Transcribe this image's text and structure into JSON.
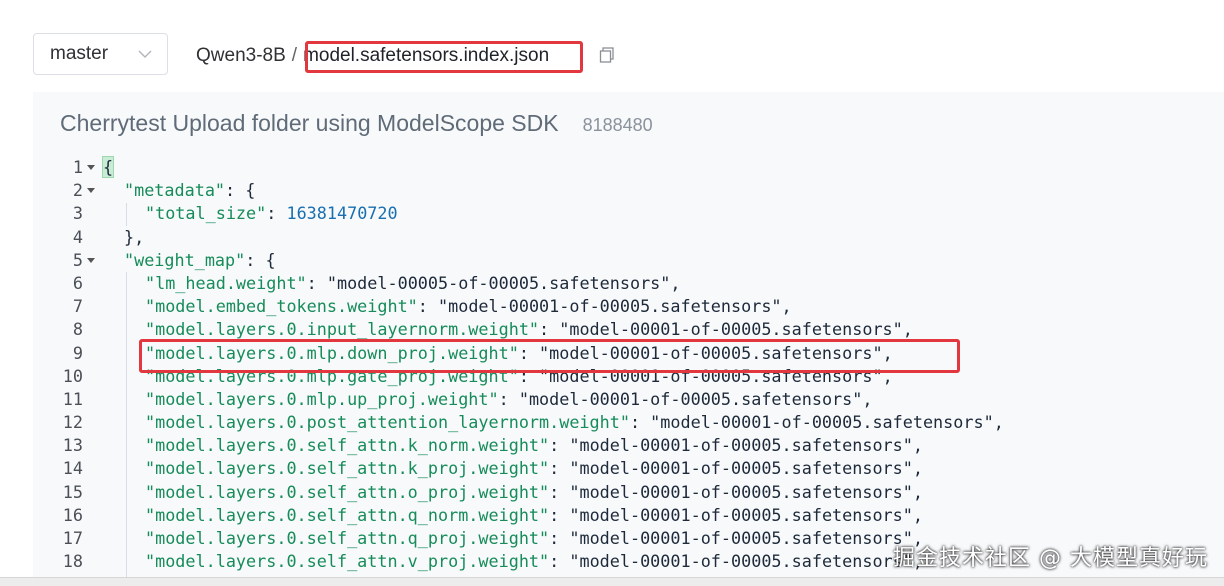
{
  "branch": {
    "selected": "master",
    "chevron_icon": "chevron-down-icon"
  },
  "breadcrumb": {
    "repo": "Qwen3-8B",
    "separator": "/",
    "file": "model.safetensors.index.json",
    "copy_icon": "copy-icon"
  },
  "commit": {
    "message": "Cherrytest Upload folder using ModelScope SDK",
    "hash": "8188480"
  },
  "code_lines": [
    {
      "n": "1",
      "text": "{"
    },
    {
      "n": "2",
      "key": "\"metadata\"",
      "rest": ": {"
    },
    {
      "n": "3",
      "key": "\"total_size\"",
      "sep": ": ",
      "num": "16381470720"
    },
    {
      "n": "4",
      "text": "},"
    },
    {
      "n": "5",
      "key": "\"weight_map\"",
      "rest": ": {"
    },
    {
      "n": "6",
      "key": "\"lm_head.weight\"",
      "sep": ": ",
      "val": "\"model-00005-of-00005.safetensors\"",
      "end": ","
    },
    {
      "n": "7",
      "key": "\"model.embed_tokens.weight\"",
      "sep": ": ",
      "val": "\"model-00001-of-00005.safetensors\"",
      "end": ","
    },
    {
      "n": "8",
      "key": "\"model.layers.0.input_layernorm.weight\"",
      "sep": ": ",
      "val": "\"model-00001-of-00005.safetensors\"",
      "end": ","
    },
    {
      "n": "9",
      "key": "\"model.layers.0.mlp.down_proj.weight\"",
      "sep": ": ",
      "val": "\"model-00001-of-00005.safetensors\"",
      "end": ","
    },
    {
      "n": "10",
      "key": "\"model.layers.0.mlp.gate_proj.weight\"",
      "sep": ": ",
      "val": "\"model-00001-of-00005.safetensors\"",
      "end": ","
    },
    {
      "n": "11",
      "key": "\"model.layers.0.mlp.up_proj.weight\"",
      "sep": ": ",
      "val": "\"model-00001-of-00005.safetensors\"",
      "end": ","
    },
    {
      "n": "12",
      "key": "\"model.layers.0.post_attention_layernorm.weight\"",
      "sep": ": ",
      "val": "\"model-00001-of-00005.safetensors\"",
      "end": ","
    },
    {
      "n": "13",
      "key": "\"model.layers.0.self_attn.k_norm.weight\"",
      "sep": ": ",
      "val": "\"model-00001-of-00005.safetensors\"",
      "end": ","
    },
    {
      "n": "14",
      "key": "\"model.layers.0.self_attn.k_proj.weight\"",
      "sep": ": ",
      "val": "\"model-00001-of-00005.safetensors\"",
      "end": ","
    },
    {
      "n": "15",
      "key": "\"model.layers.0.self_attn.o_proj.weight\"",
      "sep": ": ",
      "val": "\"model-00001-of-00005.safetensors\"",
      "end": ","
    },
    {
      "n": "16",
      "key": "\"model.layers.0.self_attn.q_norm.weight\"",
      "sep": ": ",
      "val": "\"model-00001-of-00005.safetensors\"",
      "end": ","
    },
    {
      "n": "17",
      "key": "\"model.layers.0.self_attn.q_proj.weight\"",
      "sep": ": ",
      "val": "\"model-00001-of-00005.safetensors\"",
      "end": ","
    },
    {
      "n": "18",
      "key": "\"model.layers.0.self_attn.v_proj.weight\"",
      "sep": ": ",
      "val": "\"model-00001-of-00005.safetensors\"",
      "end": ","
    }
  ],
  "watermark": "掘金技术社区 @ 大模型真好玩",
  "colors": {
    "highlight_border": "#e2373f",
    "json_key": "#178c5a",
    "json_number": "#1a6fb0",
    "panel_bg": "#f7f9fb"
  }
}
